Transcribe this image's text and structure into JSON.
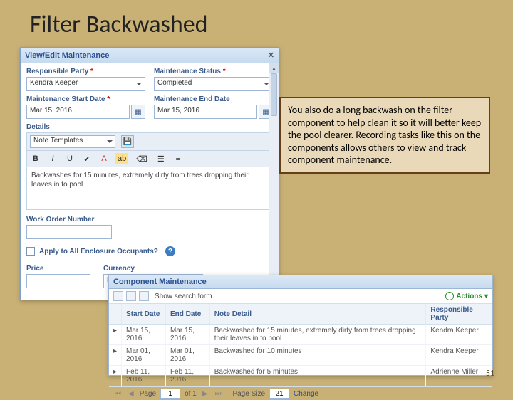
{
  "slide": {
    "title": "Filter Backwashed",
    "number": "51"
  },
  "callout": {
    "text": "You also do a long backwash on the filter component to help clean it so it will better keep the pool clearer. Recording tasks like this on the components allows others to view and track component maintenance."
  },
  "dialog": {
    "title": "View/Edit Maintenance",
    "labels": {
      "responsible_party": "Responsible Party",
      "maintenance_status": "Maintenance Status",
      "maintenance_start_date": "Maintenance Start Date",
      "maintenance_end_date": "Maintenance End Date",
      "details": "Details",
      "note_templates": "Note Templates",
      "work_order_number": "Work Order Number",
      "apply_all": "Apply to All Enclosure Occupants?",
      "price": "Price",
      "currency": "Currency"
    },
    "values": {
      "responsible_party": "Kendra Keeper",
      "maintenance_status": "Completed",
      "start_date": "Mar 15, 2016",
      "end_date": "Mar 15, 2016",
      "details_text": "Backwashes for 15 minutes, extremely dirty from trees dropping their leaves in to pool",
      "currency": "Please Select"
    },
    "editor_toolbar": {
      "bold": "B",
      "italic": "I",
      "underline": "U"
    }
  },
  "grid": {
    "title": "Component Maintenance",
    "toolbar": {
      "show_search": "Show search form",
      "actions": "Actions"
    },
    "headers": {
      "start": "Start Date",
      "end": "End Date",
      "note": "Note Detail",
      "responsible": "Responsible Party"
    },
    "rows": [
      {
        "start": "Mar 15, 2016",
        "end": "Mar 15, 2016",
        "note": "Backwashed for 15 minutes, extremely dirty from trees dropping their leaves in to pool",
        "responsible": "Kendra Keeper"
      },
      {
        "start": "Mar 01, 2016",
        "end": "Mar 01, 2016",
        "note": "Backwashed for 10 minutes",
        "responsible": "Kendra Keeper"
      },
      {
        "start": "Feb 11, 2016",
        "end": "Feb 11, 2016",
        "note": "Backwashed for 5 minutes",
        "responsible": "Adrienne Miller"
      }
    ],
    "pager": {
      "page_label": "Page",
      "page": "1",
      "of_label": "of 1",
      "size_label": "Page Size",
      "size": "21",
      "change": "Change"
    }
  }
}
